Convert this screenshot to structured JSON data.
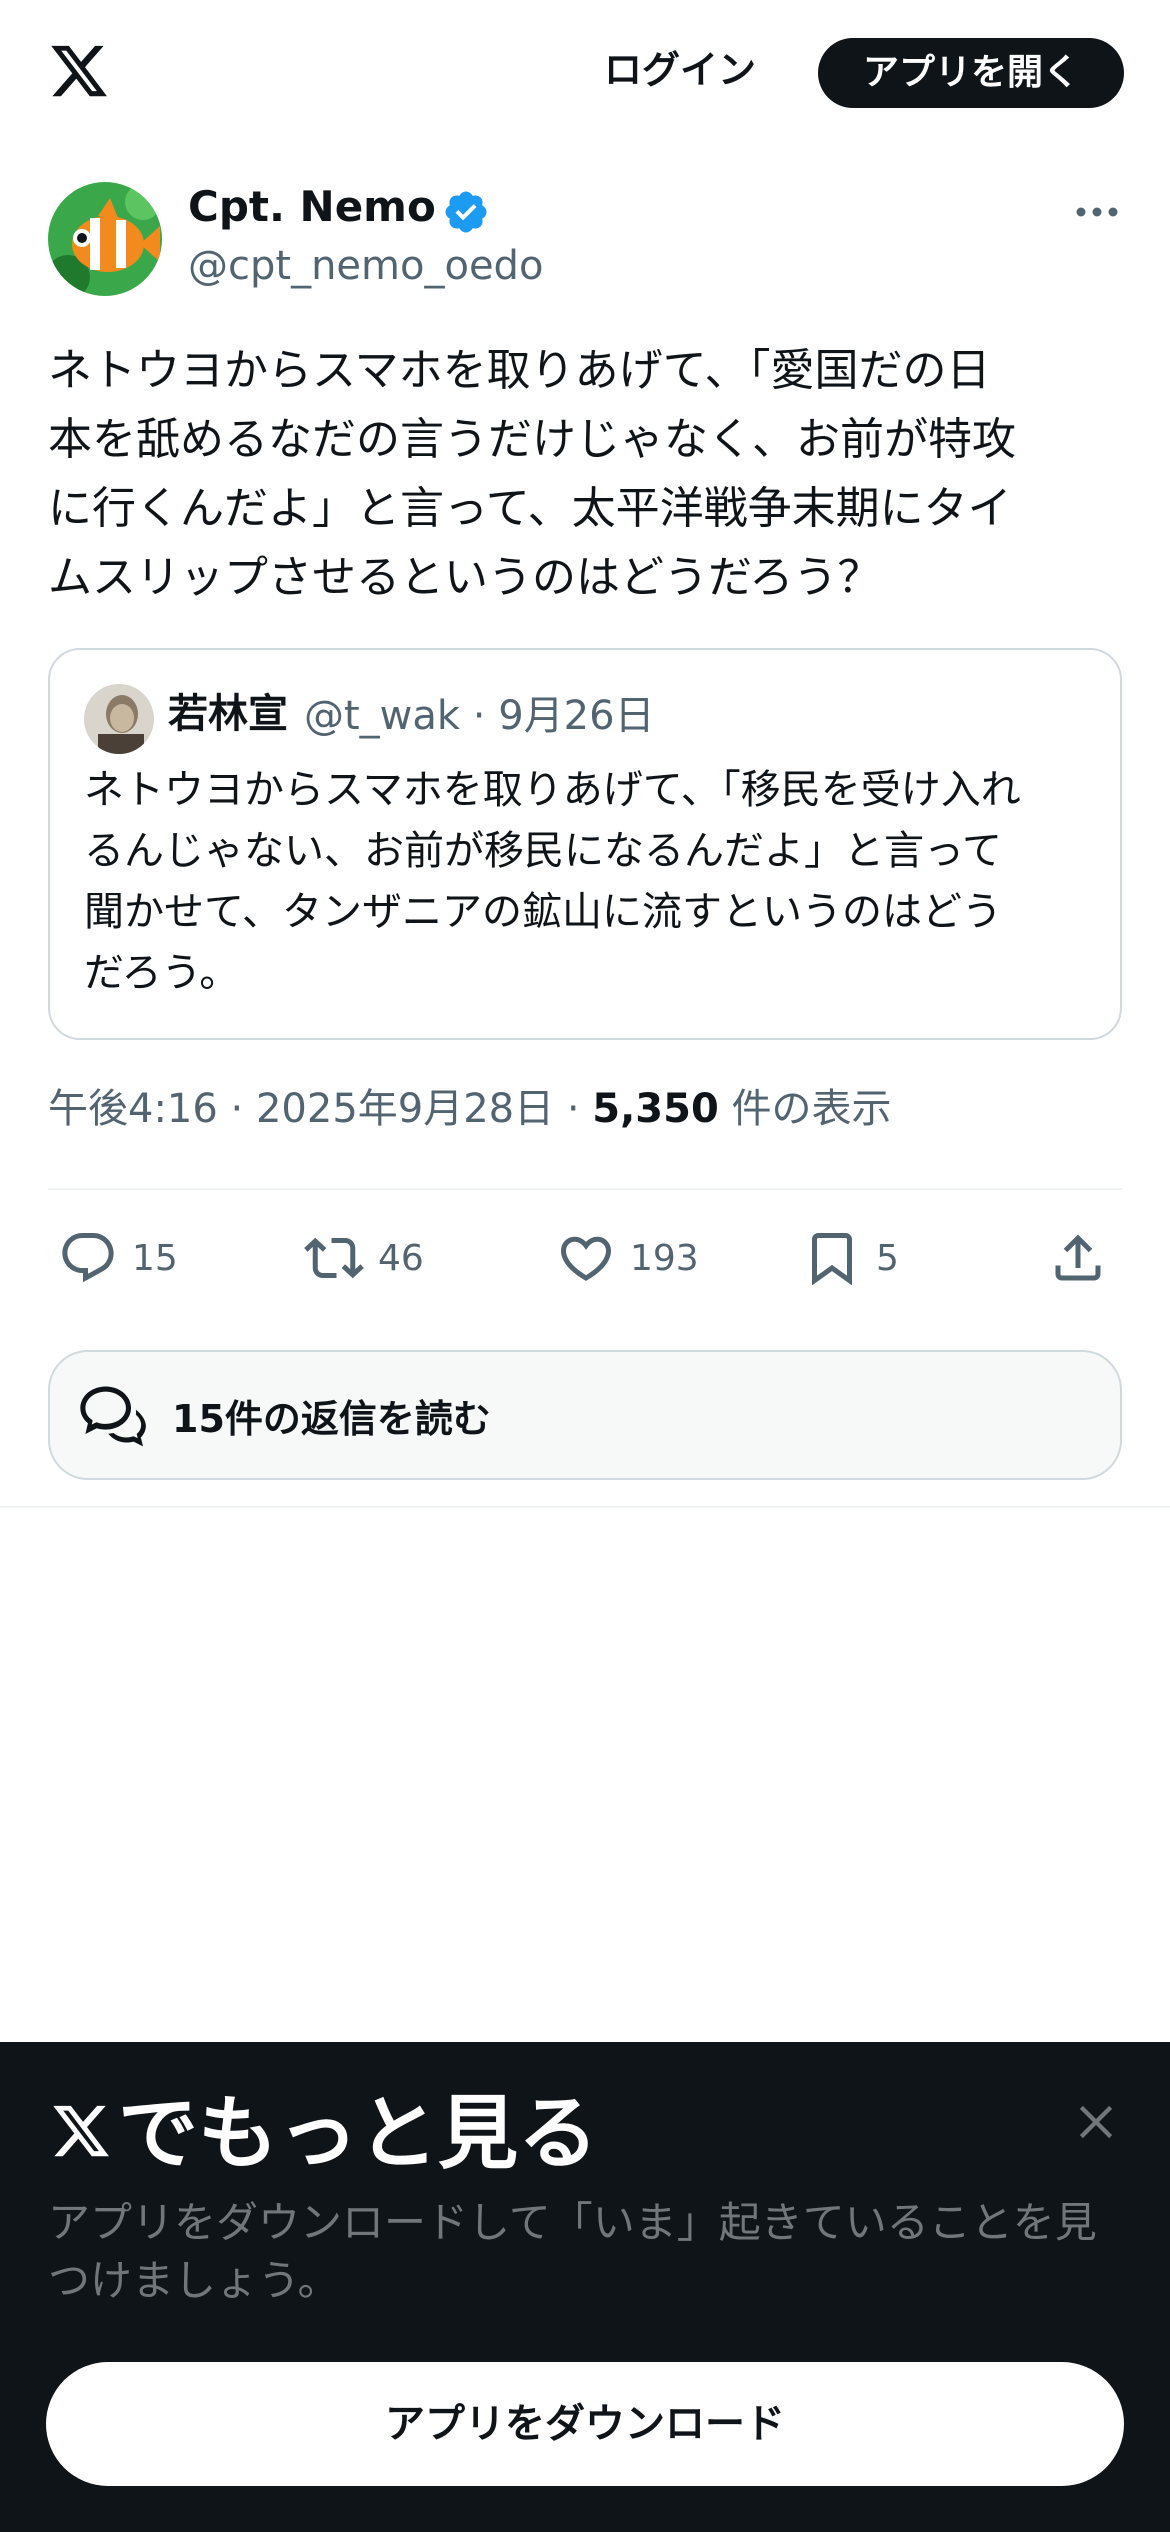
{
  "header": {
    "login_label": "ログイン",
    "open_app_label": "アプリを開く"
  },
  "tweet": {
    "author_name": "Cpt. Nemo",
    "author_handle": "@cpt_nemo_oedo",
    "verified": true,
    "text_lines": [
      "ネトウヨからスマホを取りあげて、「愛国だの日",
      "本を舐めるなだの言うだけじゃなく、お前が特攻",
      "に行くんだよ」と言って、太平洋戦争末期にタイ",
      "ムスリップさせるというのはどうだろう？"
    ],
    "quote": {
      "author_name": "若林宣",
      "meta": "@t_wak · 9月26日",
      "text_lines": [
        "ネトウヨからスマホを取りあげて、「移民を受け入れ",
        "るんじゃない、お前が移民になるんだよ」と言って",
        "聞かせて、タンザニアの鉱山に流すというのはどう",
        "だろう。"
      ]
    },
    "timestamp": "午後4:16 · 2025年9月28日 · ",
    "views_count": "5,350",
    "views_label": " 件の表示",
    "actions": {
      "replies": "15",
      "retweets": "46",
      "likes": "193",
      "bookmarks": "5"
    },
    "read_replies_label": "15件の返信を読む"
  },
  "sheet": {
    "title": "でもっと見る",
    "description_lines": [
      "アプリをダウンロードして「いま」起きていることを見",
      "つけましょう。"
    ],
    "download_label": "アプリをダウンロード"
  },
  "colors": {
    "text_primary": "#0f1419",
    "text_secondary": "#536471",
    "verified_blue": "#1d9bf0",
    "border": "#cfd9de",
    "sheet_bg": "#0f1419"
  },
  "icons": {
    "logo": "x-logo-icon",
    "verified": "verified-badge-icon",
    "more": "more-dots-icon",
    "reply": "reply-icon",
    "retweet": "retweet-icon",
    "like": "heart-icon",
    "bookmark": "bookmark-icon",
    "share": "share-icon",
    "read_replies": "chat-bubbles-icon",
    "close": "close-icon"
  }
}
